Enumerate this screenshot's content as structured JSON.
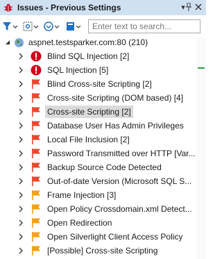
{
  "window": {
    "title": "Issues - Previous Settings"
  },
  "search": {
    "placeholder": "Enter text to search..."
  },
  "toolbar": {
    "icons": [
      "filter-icon",
      "settings-icon",
      "group-icon",
      "view-icon"
    ]
  },
  "tree": {
    "root": {
      "label": "aspnet.testsparker.com:80 (210)",
      "icon": "globe-icon"
    },
    "items": [
      {
        "label": "Blind SQL Injection [2]",
        "severity": "critical",
        "color": "#d0021b"
      },
      {
        "label": "SQL Injection [5]",
        "severity": "critical",
        "color": "#d0021b"
      },
      {
        "label": "Blind Cross-site Scripting [2]",
        "severity": "high",
        "color": "#e8482e"
      },
      {
        "label": "Cross-site Scripting (DOM based) [4]",
        "severity": "high",
        "color": "#e8482e"
      },
      {
        "label": "Cross-site Scripting [2]",
        "severity": "high",
        "color": "#e8482e",
        "selected": true
      },
      {
        "label": "Database User Has Admin Privileges",
        "severity": "high",
        "color": "#e8482e"
      },
      {
        "label": "Local File Inclusion [2]",
        "severity": "high",
        "color": "#e8482e"
      },
      {
        "label": "Password Transmitted over HTTP [Var...",
        "severity": "high",
        "color": "#e8482e"
      },
      {
        "label": "Backup Source Code Detected",
        "severity": "high",
        "color": "#e8482e"
      },
      {
        "label": "Out-of-date Version (Microsoft SQL S...",
        "severity": "high",
        "color": "#e8482e"
      },
      {
        "label": "Frame Injection [3]",
        "severity": "medium",
        "color": "#f4a012"
      },
      {
        "label": "Open Policy Crossdomain.xml Detect...",
        "severity": "medium",
        "color": "#f4a012"
      },
      {
        "label": "Open Redirection",
        "severity": "medium",
        "color": "#f4a012"
      },
      {
        "label": "Open Silverlight Client Access Policy",
        "severity": "medium",
        "color": "#f4a012"
      },
      {
        "label": "[Possible] Cross-site Scripting",
        "severity": "medium",
        "color": "#f4a012"
      }
    ]
  },
  "colors": {
    "titlebar": "#cfe0f1",
    "selection": "#dadada",
    "scroll_marker": "#2e9e3c"
  }
}
